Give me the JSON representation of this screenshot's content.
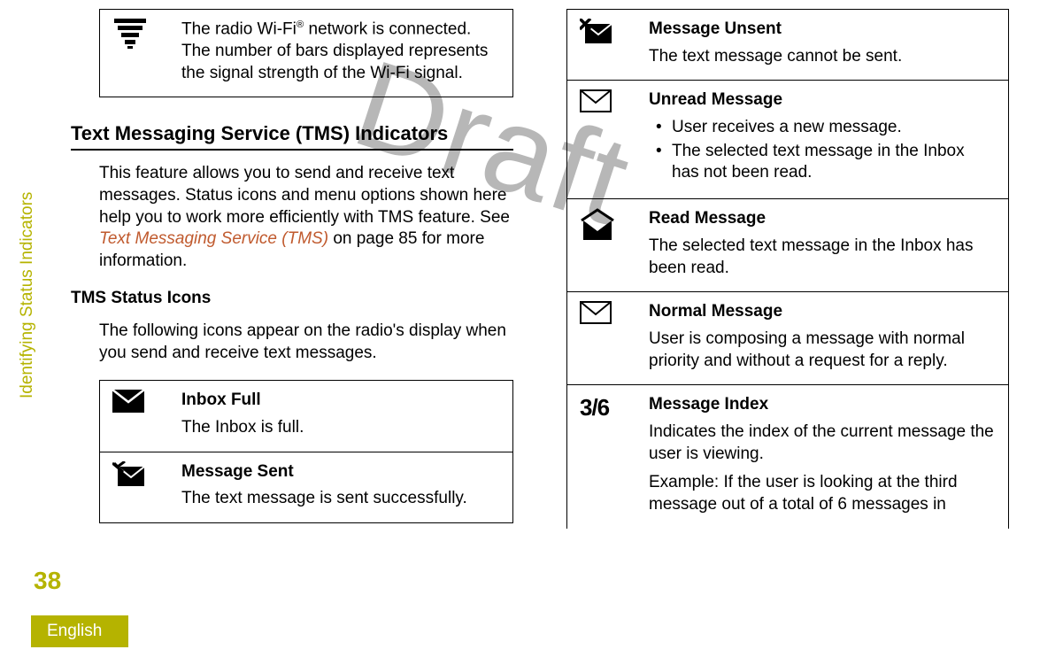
{
  "sidebar": {
    "section_label": "Identifying Status Indicators",
    "page_number": "38",
    "language": "English"
  },
  "watermark": "Draft",
  "left": {
    "wifi_row": {
      "desc_prefix": "The radio Wi-Fi",
      "desc_suffix": " network is connected. The number of bars displayed represents the signal strength of the Wi-Fi signal.",
      "reg": "®"
    },
    "heading": "Text Messaging Service (TMS) Indicators",
    "intro_prefix": "This feature allows you to send and receive text messages. Status icons and menu options shown here help you to work more efficiently with TMS feature. See ",
    "intro_link": "Text Messaging Service (TMS)",
    "intro_suffix": " on page 85 for more information.",
    "sub_heading": "TMS Status Icons",
    "sub_intro": "The following icons appear on the radio's display when you send and receive text messages.",
    "inbox_full": {
      "title": "Inbox Full",
      "desc": "The Inbox is full."
    },
    "msg_sent": {
      "title": "Message Sent",
      "desc": "The text message is sent successfully."
    }
  },
  "right": {
    "msg_unsent": {
      "title": "Message Unsent",
      "desc": "The text message cannot be sent."
    },
    "unread": {
      "title": "Unread Message",
      "b1": "User receives a new message.",
      "b2": "The selected text message in the Inbox has not been read."
    },
    "read": {
      "title": "Read Message",
      "desc": "The selected text message in the Inbox has been read."
    },
    "normal": {
      "title": "Normal Message",
      "desc": "User is composing a message with normal priority and without a request for a reply."
    },
    "index": {
      "icon_text": "3/6",
      "title": "Message Index",
      "p1": "Indicates the index of the current message the user is viewing.",
      "p2": "Example: If the user is looking at the third message out of a total of 6 messages in"
    }
  }
}
